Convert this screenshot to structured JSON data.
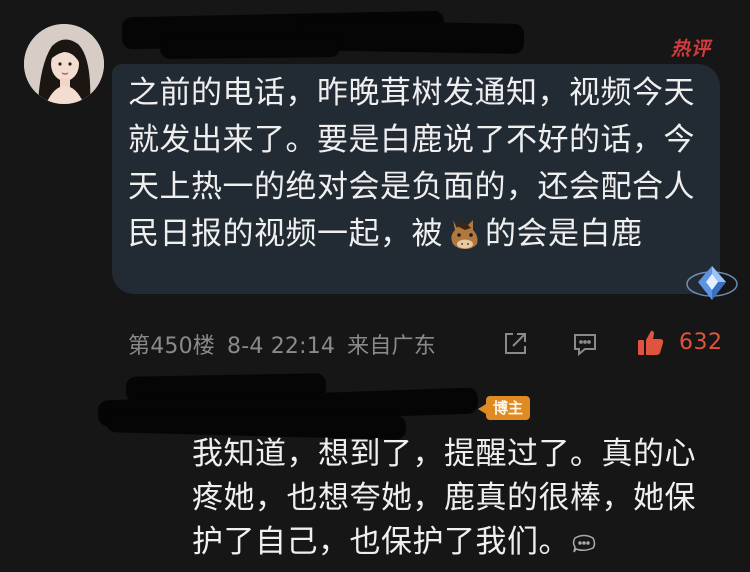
{
  "comment": {
    "hot_badge": "热评",
    "text_before_emoji": "之前的电话，昨晚茸树发通知，视频今天就发出来了。要是白鹿说了不好的话，今天上热一的绝对会是负面的，还会配合人民日报的视频一起，被",
    "emoji": "horse-face-emoji",
    "text_after_emoji": "的会是白鹿",
    "floor": "第450楼",
    "date": "8-4 22:14",
    "location": "来自广东",
    "like_count": "632",
    "icons": [
      "share-icon",
      "comment-icon",
      "thumbs-up-icon",
      "diamond-badge-icon"
    ]
  },
  "reply": {
    "author_badge": "博主",
    "text": "我知道，想到了，提醒过了。真的心疼她，也想夸她，鹿真的很棒，她保护了自己，也保护了我们。",
    "tail_icon": "more-replies-icon"
  },
  "colors": {
    "background": "#161616",
    "bubble": "#222a33",
    "hot": "#d23b3b",
    "like": "#e0533e",
    "badge": "#e08a24"
  }
}
